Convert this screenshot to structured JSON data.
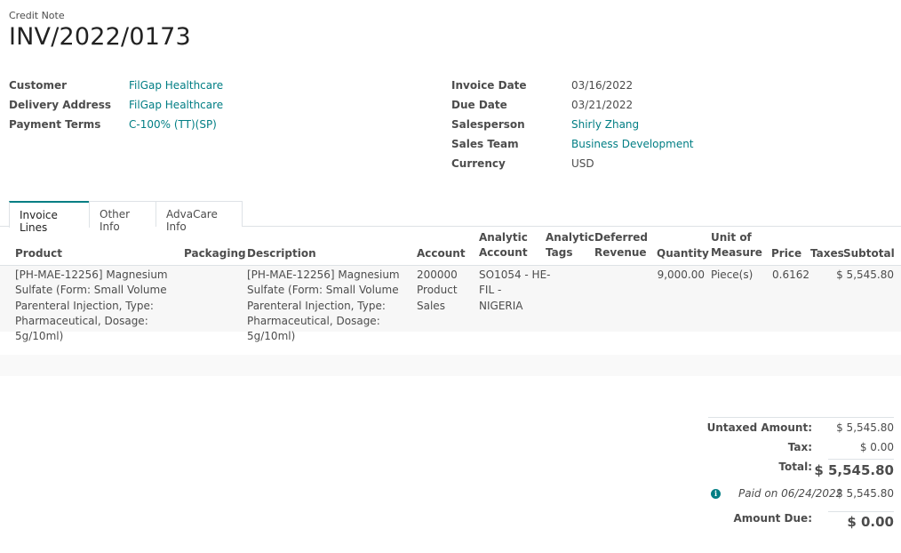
{
  "header": {
    "doc_type": "Credit Note",
    "title": "INV/2022/0173"
  },
  "left_fields": [
    {
      "label": "Customer",
      "value": "FilGap Healthcare",
      "link": true
    },
    {
      "label": "Delivery Address",
      "value": "FilGap Healthcare",
      "link": true
    },
    {
      "label": "Payment Terms",
      "value": "C-100% (TT)(SP)",
      "link": true
    }
  ],
  "right_fields": [
    {
      "label": "Invoice Date",
      "value": "03/16/2022",
      "link": false
    },
    {
      "label": "Due Date",
      "value": "03/21/2022",
      "link": false
    },
    {
      "label": "Salesperson",
      "value": "Shirly Zhang",
      "link": true
    },
    {
      "label": "Sales Team",
      "value": "Business Development",
      "link": true
    },
    {
      "label": "Currency",
      "value": "USD",
      "link": false
    }
  ],
  "tabs": [
    {
      "label": "Invoice Lines",
      "active": true
    },
    {
      "label": "Other Info",
      "active": false
    },
    {
      "label": "AdvaCare Info",
      "active": false
    }
  ],
  "table": {
    "columns": {
      "product": "Product",
      "packaging": "Packaging",
      "description": "Description",
      "account": "Account",
      "analytic_account_1": "Analytic",
      "analytic_account_2": "Account",
      "analytic_tags_1": "Analytic",
      "analytic_tags_2": "Tags",
      "deferred_revenue_1": "Deferred",
      "deferred_revenue_2": "Revenue",
      "quantity": "Quantity",
      "uom_1": "Unit of",
      "uom_2": "Measure",
      "price": "Price",
      "taxes": "Taxes",
      "subtotal": "Subtotal"
    },
    "rows": [
      {
        "product": [
          "[PH-MAE-12256] Magnesium",
          "Sulfate (Form: Small Volume",
          "Parenteral Injection, Type:",
          "Pharmaceutical, Dosage: 5g/10ml)"
        ],
        "packaging": "",
        "description": [
          "[PH-MAE-12256] Magnesium",
          "Sulfate (Form: Small Volume",
          "Parenteral Injection, Type:",
          "Pharmaceutical, Dosage: 5g/10ml)"
        ],
        "account": [
          "200000",
          "Product",
          "Sales"
        ],
        "analytic_account": [
          "SO1054 - HE-",
          "FIL -",
          "NIGERIA"
        ],
        "analytic_tags": "",
        "deferred_revenue": "",
        "quantity": "9,000.00",
        "uom": "Piece(s)",
        "price": "0.6162",
        "taxes": "",
        "subtotal": "$ 5,545.80"
      }
    ]
  },
  "totals": {
    "untaxed_label": "Untaxed Amount:",
    "untaxed_value": "$ 5,545.80",
    "tax_label": "Tax:",
    "tax_value": "$ 0.00",
    "total_label": "Total:",
    "total_value": "$ 5,545.80",
    "paid_on": "Paid on 06/24/2022",
    "paid_value": "$ 5,545.80",
    "amount_due_label": "Amount Due:",
    "amount_due_value": "$ 0.00"
  },
  "colors": {
    "link": "#017e84",
    "highlight": "#ffff4d"
  },
  "icons": {
    "payment_info": "info-circle-icon"
  }
}
